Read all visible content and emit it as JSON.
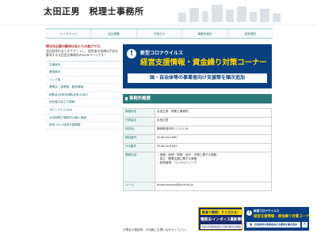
{
  "header": {
    "logo": "太田正男　税理士事務所"
  },
  "nav": [
    "トップページ",
    "会社概要",
    "お知らせ",
    "事務所案内",
    "経営理念"
  ],
  "sidebar": {
    "intro_title": "関与先企業の繁栄は私たちの喜びです。",
    "intro_text": "会社経営の全てをサポートし、経営者の皆様の不安を解消する太田会計事務所のWEBページです！",
    "items": [
      "交通案内",
      "業務案内",
      "リンク集",
      "開業会・創業塾・融資情報",
      "補助金(持続化補助金等)の紹介",
      "経営者お役立ち情報",
      "TKCシステムQ&A",
      "太田税理士事務所の職人情報",
      "新型コロナ経営支援情報"
    ]
  },
  "banner": {
    "small": "新型コロナウイルス",
    "big": "経営支援情報・資金繰り対策コーナー",
    "strip": "国・自治体等の事業者向け支援策を順次追加"
  },
  "section": {
    "title": "事務所概要"
  },
  "table": [
    {
      "key": "事務所名",
      "value": "太田正男　税理士事務所"
    },
    {
      "key": "代表者名",
      "value": "太田正男"
    },
    {
      "key": "所在地",
      "value": "静岡県島田市○○1-3-16"
    },
    {
      "key": "電話番号",
      "value": "0548-44-4060"
    },
    {
      "key": "FAX番号",
      "value": "0548-44-4061"
    },
    {
      "key": "業務内容",
      "value": "・税務・経理・財務・会計・決算に関する業務\n・独立・開業支援に関する業務\n・経営管理・コンサルティング"
    },
    {
      "key": "メール",
      "value": "ohtanomasao@tkcnf.or.jp"
    }
  ],
  "footer_note": "お問合せ電話等、お気軽にお問い合わせください。",
  "overlay_left": {
    "top": "動画で解説！すぐ分かる！",
    "mid": "電帳法/インボイス最新情報",
    "bottom": "令和5年度税制改正大綱の要点を解説"
  },
  "overlay_right": {
    "small": "新型コロナウイルス",
    "big": "経営支援情報・資金繰り対策コーナー",
    "strip": "国・自治体等の事業者向け支援策を順次追加",
    "close": "×"
  }
}
